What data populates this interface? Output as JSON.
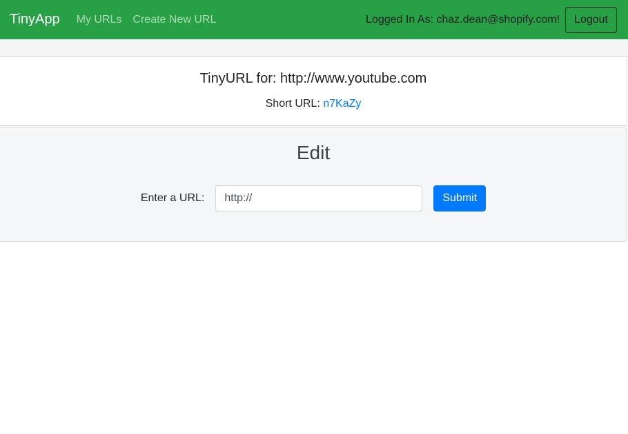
{
  "navbar": {
    "brand": "TinyApp",
    "links": [
      {
        "label": "My URLs"
      },
      {
        "label": "Create New URL"
      }
    ],
    "logged_in_text": "Logged In As: chaz.dean@shopify.com!",
    "logout_label": "Logout"
  },
  "info_card": {
    "title": "TinyURL for: http://www.youtube.com",
    "short_url_label": "Short URL: ",
    "short_url": "n7KaZy"
  },
  "edit_card": {
    "title": "Edit",
    "url_label": "Enter a URL:",
    "url_placeholder": "http://",
    "submit_label": "Submit"
  },
  "colors": {
    "navbar": "#28a046",
    "link": "#007bff",
    "primary_button": "#007bff"
  }
}
